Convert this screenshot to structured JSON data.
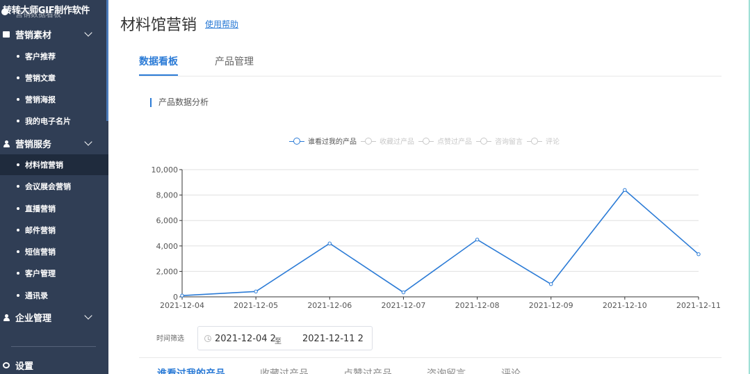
{
  "sidebar": {
    "logo_text": "转转大师GIF制作软件",
    "ghost_text": "营销数据看板",
    "groups": [
      {
        "label": "营销素材",
        "icon": "folder-icon"
      },
      {
        "label": "营销服务",
        "icon": "user-icon"
      },
      {
        "label": "企业管理",
        "icon": "user-icon"
      },
      {
        "label": "设置",
        "icon": "gear-icon"
      }
    ],
    "items": [
      {
        "label": "客户推荐"
      },
      {
        "label": "营销文章"
      },
      {
        "label": "营销海报"
      },
      {
        "label": "我的电子名片"
      },
      {
        "label": "材料馆营销",
        "active": true
      },
      {
        "label": "会议展会营销"
      },
      {
        "label": "直播营销"
      },
      {
        "label": "邮件营销"
      },
      {
        "label": "短信营销"
      },
      {
        "label": "客户管理"
      },
      {
        "label": "通讯录"
      }
    ]
  },
  "header": {
    "title": "材料馆营销",
    "help_link": "使用帮助"
  },
  "tabs": [
    {
      "label": "数据看板",
      "active": true
    },
    {
      "label": "产品管理",
      "active": false
    }
  ],
  "section_title": "产品数据分析",
  "legend": [
    {
      "label": "谁看过我的产品",
      "active": true
    },
    {
      "label": "收藏过产品",
      "active": false
    },
    {
      "label": "点赞过产品",
      "active": false
    },
    {
      "label": "咨询留言",
      "active": false
    },
    {
      "label": "评论",
      "active": false
    }
  ],
  "filter": {
    "label": "时间筛选",
    "start": "2021-12-04 2",
    "separator": "至",
    "end": "2021-12-11 2"
  },
  "bottom_tabs": [
    {
      "label": "谁看过我的产品",
      "active": true
    },
    {
      "label": "收藏过产品",
      "active": false
    },
    {
      "label": "点赞过产品",
      "active": false
    },
    {
      "label": "咨询留言",
      "active": false
    },
    {
      "label": "评论",
      "active": false
    }
  ],
  "colors": {
    "accent": "#2b7bd6",
    "sidebar_bg": "#303e55",
    "sidebar_active": "#1f2b3d",
    "legend_inactive": "#c8c8c8"
  },
  "chart_data": {
    "type": "line",
    "x": [
      "2021-12-04",
      "2021-12-05",
      "2021-12-06",
      "2021-12-07",
      "2021-12-08",
      "2021-12-09",
      "2021-12-10",
      "2021-12-11"
    ],
    "series": [
      {
        "name": "谁看过我的产品",
        "values": [
          100,
          420,
          4200,
          350,
          4500,
          1000,
          8400,
          3350
        ]
      }
    ],
    "ylim": [
      0,
      10000
    ],
    "yticks": [
      "0",
      "2,000",
      "4,000",
      "6,000",
      "8,000",
      "10,000"
    ],
    "grid": true,
    "legend_position": "top-center"
  }
}
